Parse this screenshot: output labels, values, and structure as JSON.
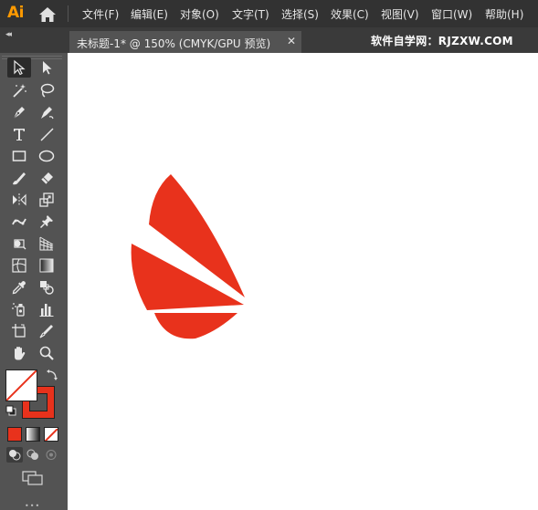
{
  "app": {
    "logo_text": "Ai"
  },
  "menu": {
    "items": [
      "文件(F)",
      "编辑(E)",
      "对象(O)",
      "文字(T)",
      "选择(S)",
      "效果(C)",
      "视图(V)",
      "窗口(W)",
      "帮助(H)"
    ]
  },
  "tab": {
    "title": "未标题-1* @ 150% (CMYK/GPU 预览)",
    "close_glyph": "✕",
    "collapse_glyph": "◂◂"
  },
  "watermark": "软件自学网：RJZXW.COM",
  "colors": {
    "artwork_fill": "#e8321c",
    "menubar_bg": "#323232",
    "panel_bg": "#535353",
    "logo": "#ff9a00"
  },
  "toolbar": {
    "tools": [
      "selection-tool",
      "direct-selection-tool",
      "magic-wand-tool",
      "lasso-tool",
      "pen-tool",
      "curvature-tool",
      "type-tool",
      "line-segment-tool",
      "rectangle-tool",
      "ellipse-tool",
      "paintbrush-tool",
      "eraser-tool",
      "reflect-tool",
      "scale-tool",
      "puppet-warp-tool",
      "pin-tool",
      "free-transform-tool",
      "perspective-grid-tool",
      "mesh-tool",
      "gradient-tool",
      "eyedropper-tool",
      "blend-tool",
      "symbol-sprayer-tool",
      "column-graph-tool",
      "artboard-tool",
      "slice-tool",
      "hand-tool",
      "zoom-tool"
    ],
    "active_tool": "selection-tool",
    "fill": "none",
    "stroke": "#e8321c"
  }
}
